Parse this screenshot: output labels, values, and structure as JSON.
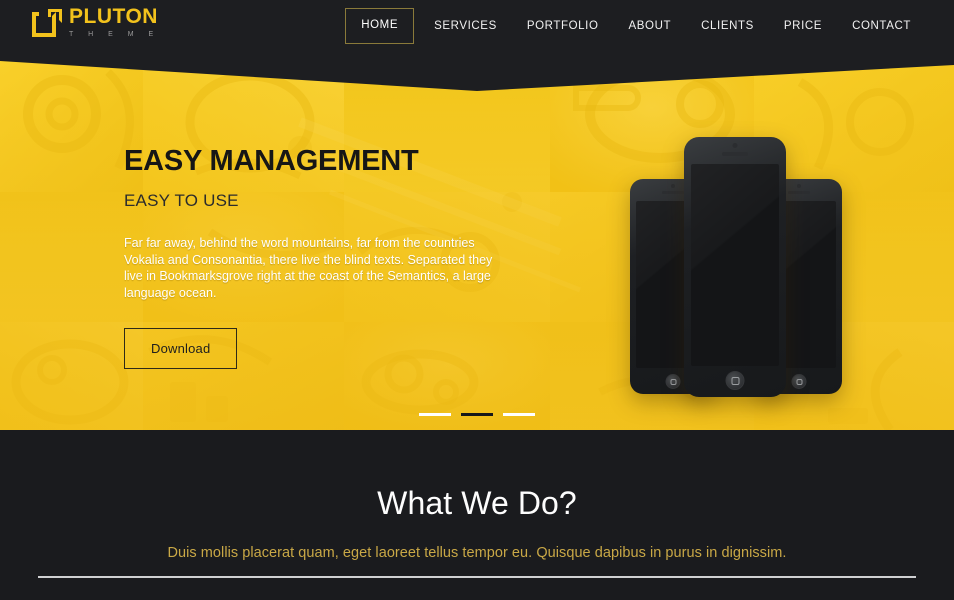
{
  "header": {
    "logo": {
      "mark_icon": "bracket-square-icon",
      "name": "PLUTON",
      "sub": "T H E M E"
    },
    "nav": [
      {
        "label": "HOME",
        "active": true
      },
      {
        "label": "SERVICES",
        "active": false
      },
      {
        "label": "PORTFOLIO",
        "active": false
      },
      {
        "label": "ABOUT",
        "active": false
      },
      {
        "label": "CLIENTS",
        "active": false
      },
      {
        "label": "PRICE",
        "active": false
      },
      {
        "label": "CONTACT",
        "active": false
      }
    ]
  },
  "hero": {
    "title": "EASY MANAGEMENT",
    "subtitle": "EASY TO USE",
    "description": "Far far away, behind the word mountains, far from the countries Vokalia and Consonantia, there live the blind texts. Separated they live in Bookmarksgrove right at the coast of the Semantics, a large language ocean.",
    "button_label": "Download",
    "devices": [
      {
        "name": "phone-left"
      },
      {
        "name": "phone-center"
      },
      {
        "name": "phone-right"
      }
    ],
    "slider": {
      "total": 3,
      "active_index": 2,
      "items": [
        {
          "label": "slide-1"
        },
        {
          "label": "slide-2"
        },
        {
          "label": "slide-3"
        }
      ]
    }
  },
  "section": {
    "title": "What We Do?",
    "subtitle": "Duis mollis placerat quam, eget laoreet tellus tempor eu. Quisque dapibus in purus in dignissim."
  },
  "colors": {
    "brand_yellow": "#f2c21c",
    "dark_bg": "#1a1b1e",
    "header_bg": "#1d1e21",
    "nav_active_border": "#8a7a3a",
    "section_sub": "#c9a846",
    "rule": "#cfd0d2",
    "hero_text_dark": "#161616"
  }
}
